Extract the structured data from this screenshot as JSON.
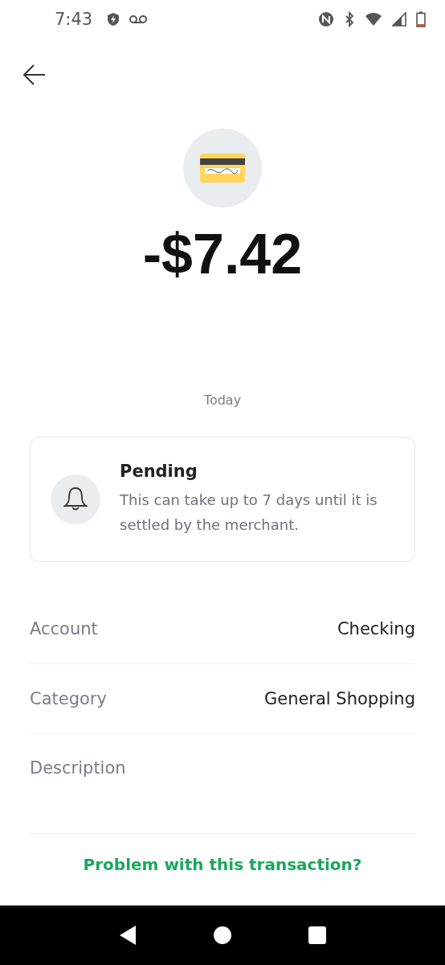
{
  "status_bar": {
    "time": "7:43"
  },
  "transaction": {
    "amount": "-$7.42",
    "date": "Today"
  },
  "notice": {
    "title": "Pending",
    "message": "This can take up to 7 days until it is settled by the merchant."
  },
  "details": [
    {
      "label": "Account",
      "value": "Checking"
    },
    {
      "label": "Category",
      "value": "General Shopping"
    },
    {
      "label": "Description"
    }
  ],
  "help_link": "Problem with this transaction?"
}
